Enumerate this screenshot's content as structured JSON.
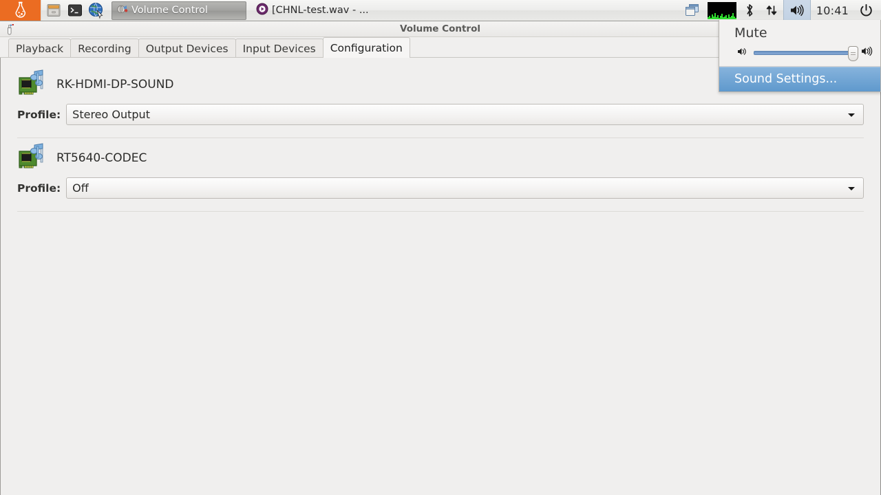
{
  "taskbar": {
    "start_button": {
      "name": "lubuntu-start-button",
      "icon": "bottle-icon"
    },
    "launchers": [
      {
        "name": "file-manager",
        "icon": "file-manager-icon"
      },
      {
        "name": "terminal",
        "icon": "terminal-icon"
      },
      {
        "name": "web-browser",
        "icon": "globe-icon"
      }
    ],
    "windows": [
      {
        "label": "Volume Control",
        "active": true,
        "icon": "volume-control-icon"
      },
      {
        "label": "[CHNL-test.wav - ...",
        "active": false,
        "icon": "media-player-icon"
      }
    ],
    "tray": {
      "show_desktop": "show-desktop-icon",
      "monitor": "network-monitor-graph",
      "bluetooth": "bluetooth-icon",
      "network": "network-updown-icon",
      "volume": "volume-icon",
      "clock": "10:41",
      "power": "power-icon"
    }
  },
  "volume_menu": {
    "mute_label": "Mute",
    "low_volume_icon": "volume-low-icon",
    "high_volume_icon": "volume-high-icon",
    "slider_value": 100,
    "sound_settings_label": "Sound Settings...",
    "highlight_color": "#5f99cd"
  },
  "window": {
    "title": "Volume Control",
    "icon": "volume-control-icon",
    "tabs": [
      {
        "label": "Playback",
        "active": false
      },
      {
        "label": "Recording",
        "active": false
      },
      {
        "label": "Output Devices",
        "active": false
      },
      {
        "label": "Input Devices",
        "active": false
      },
      {
        "label": "Configuration",
        "active": true
      }
    ],
    "devices": [
      {
        "name": "RK-HDMI-DP-SOUND",
        "icon": "sound-card-icon",
        "profile_label": "Profile:",
        "profile_value": "Stereo Output"
      },
      {
        "name": "RT5640-CODEC",
        "icon": "sound-card-icon",
        "profile_label": "Profile:",
        "profile_value": "Off"
      }
    ]
  }
}
